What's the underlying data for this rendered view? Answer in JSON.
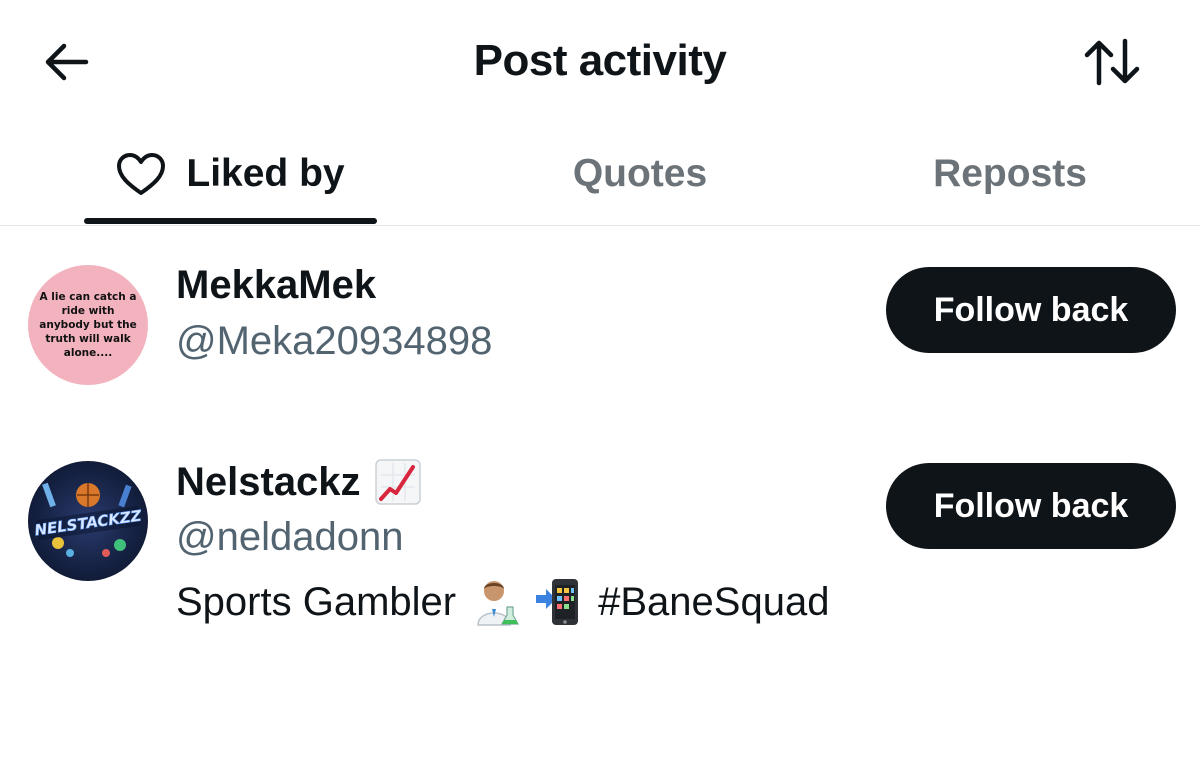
{
  "header": {
    "title": "Post activity",
    "back_icon": "arrow-left-icon",
    "sort_icon": "sort-arrows-icon"
  },
  "tabs": [
    {
      "label": "Liked by",
      "icon": "heart-outline-icon",
      "active": true
    },
    {
      "label": "Quotes",
      "active": false
    },
    {
      "label": "Reposts",
      "active": false
    }
  ],
  "users": [
    {
      "display_name": "MekkaMek",
      "handle": "@Meka20934898",
      "avatar_text": "A lie can catch a ride with anybody but the truth will walk alone....",
      "follow_label": "Follow back"
    },
    {
      "display_name": "Nelstackz",
      "name_emoji": "chart-increasing-icon",
      "handle": "@neldadonn",
      "avatar_text": "NELSTACKZZ",
      "bio_text": "Sports Gambler",
      "bio_emojis": [
        "scientist-emoji",
        "mobile-phone-arrow-emoji"
      ],
      "bio_hashtag": "#BaneSquad",
      "follow_label": "Follow back"
    }
  ],
  "colors": {
    "text_primary": "#0f1419",
    "text_secondary": "#536471",
    "tab_inactive": "#6b7278",
    "button_bg": "#0f1419",
    "button_text": "#ffffff",
    "avatar1_bg": "#f2b3bf"
  }
}
